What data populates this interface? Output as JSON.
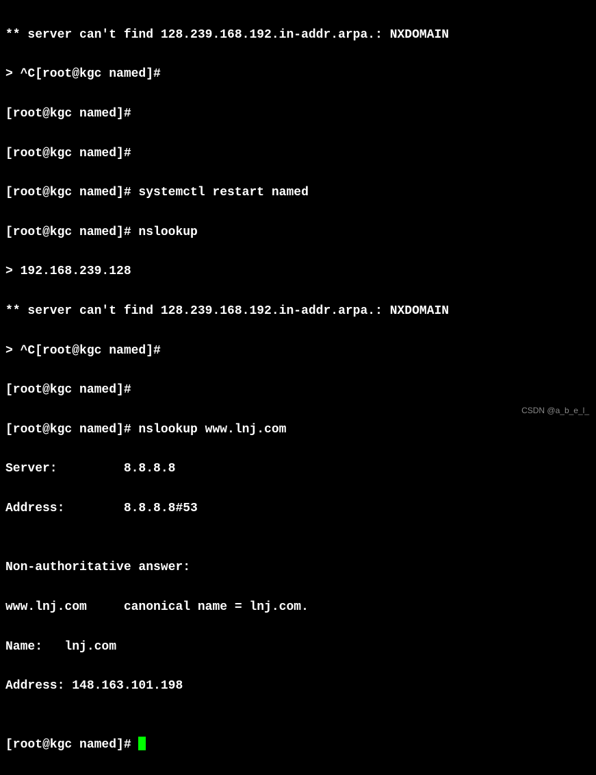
{
  "lines": [
    "** server can't find 128.239.168.192.in-addr.arpa.: NXDOMAIN",
    "> ^C[root@kgc named]#",
    "[root@kgc named]#",
    "[root@kgc named]#",
    "[root@kgc named]# systemctl restart named",
    "[root@kgc named]# nslookup",
    "> 192.168.239.128",
    "** server can't find 128.239.168.192.in-addr.arpa.: NXDOMAIN",
    "> ^C[root@kgc named]#",
    "[root@kgc named]#",
    "[root@kgc named]# nslookup www.lnj.com",
    "Server:         8.8.8.8",
    "Address:        8.8.8.8#53",
    "",
    "Non-authoritative answer:",
    "www.lnj.com     canonical name = lnj.com.",
    "Name:   lnj.com",
    "Address: 148.163.101.198",
    "",
    "[root@kgc named]# "
  ],
  "watermark": "CSDN @a_b_e_l_"
}
